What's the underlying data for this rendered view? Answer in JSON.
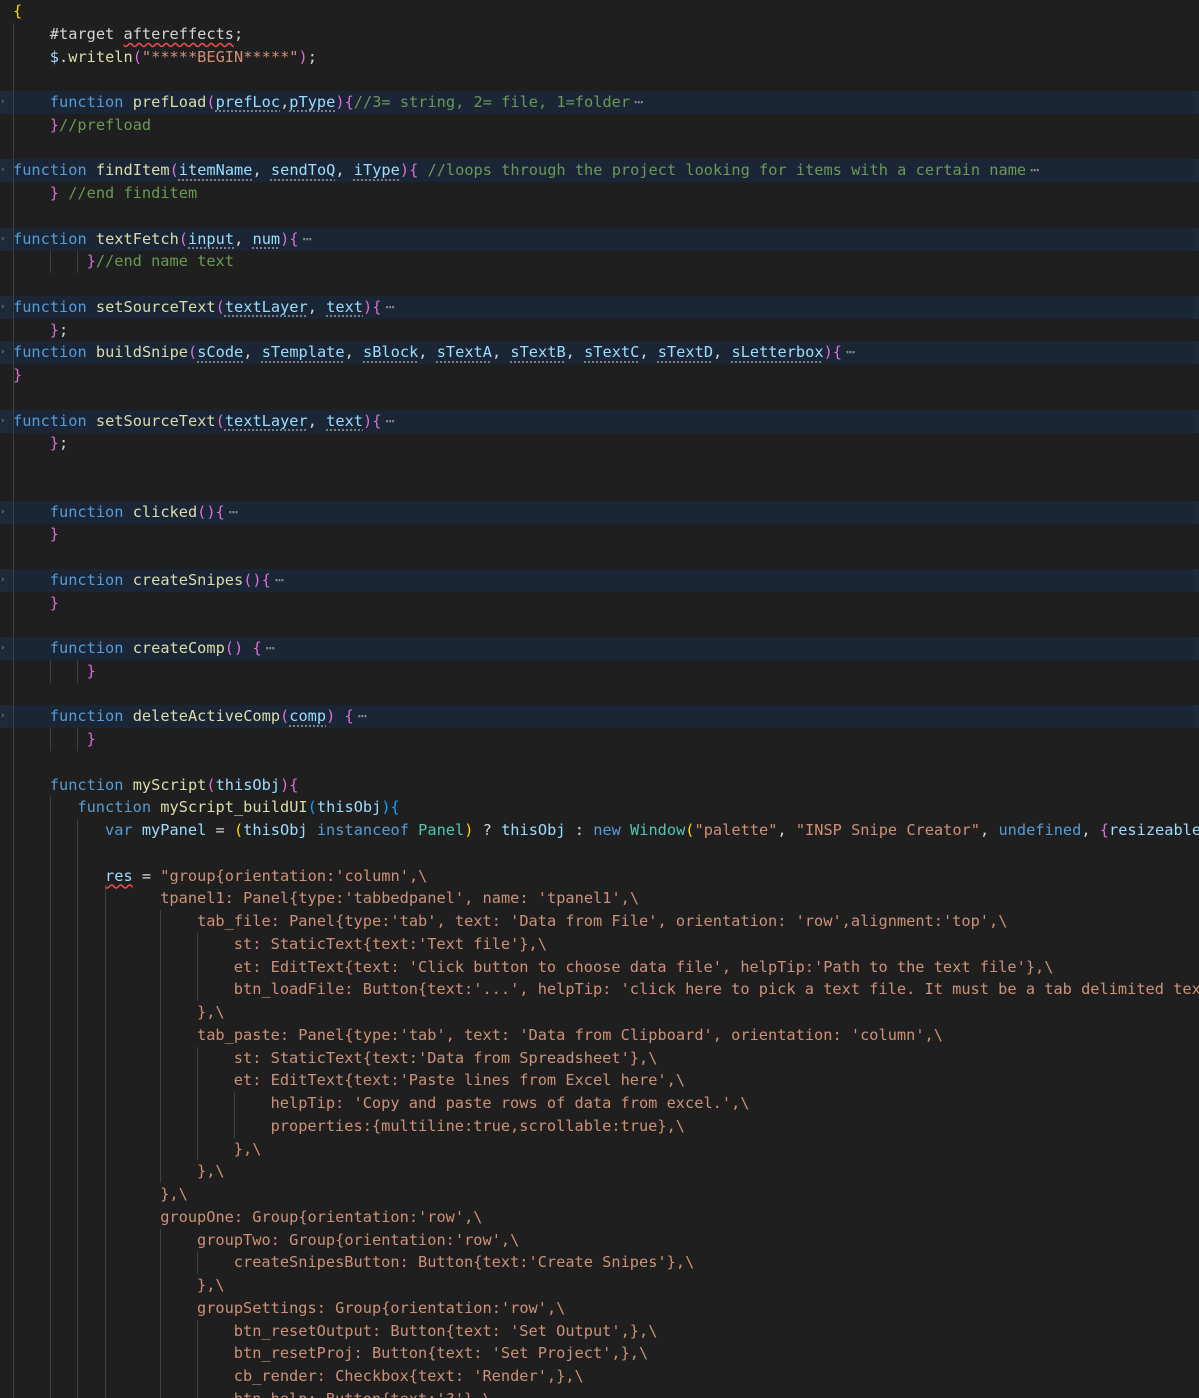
{
  "editor": {
    "fold_ellipsis": "⋯",
    "lines": [
      {
        "n": 1,
        "indent": 0,
        "folded": false,
        "tokens": [
          [
            "{",
            "b1"
          ]
        ]
      },
      {
        "n": 2,
        "indent": 4,
        "folded": false,
        "tokens": [
          [
            "#target ",
            "pl"
          ],
          [
            "aftereffects",
            "pl sq"
          ],
          [
            ";",
            "pl"
          ]
        ]
      },
      {
        "n": 3,
        "indent": 4,
        "folded": false,
        "tokens": [
          [
            "$",
            "p"
          ],
          [
            ".",
            "pl"
          ],
          [
            "writeln",
            "f"
          ],
          [
            "(",
            "b2"
          ],
          [
            "\"*****BEGIN*****\"",
            "s"
          ],
          [
            ")",
            "b2"
          ],
          [
            ";",
            "pl"
          ]
        ]
      },
      {
        "n": 4,
        "indent": 0,
        "folded": false,
        "tokens": []
      },
      {
        "n": 5,
        "indent": 4,
        "folded": true,
        "tokens": [
          [
            "function ",
            "k"
          ],
          [
            "prefLoad",
            "f"
          ],
          [
            "(",
            "b2"
          ],
          [
            "prefLoc",
            "p dt"
          ],
          [
            ",",
            "pl"
          ],
          [
            "pType",
            "p dt"
          ],
          [
            ")",
            "b2"
          ],
          [
            "{",
            "b2"
          ],
          [
            "//3= string, 2= file, 1=folder",
            "c"
          ]
        ]
      },
      {
        "n": 6,
        "indent": 4,
        "folded": false,
        "tokens": [
          [
            "}",
            "b2"
          ],
          [
            "//prefload",
            "c"
          ]
        ]
      },
      {
        "n": 7,
        "indent": 0,
        "folded": false,
        "tokens": []
      },
      {
        "n": 8,
        "indent": 0,
        "folded": true,
        "tokens": [
          [
            "function ",
            "k"
          ],
          [
            "findItem",
            "f"
          ],
          [
            "(",
            "b2"
          ],
          [
            "itemName",
            "p dt"
          ],
          [
            ", ",
            "pl"
          ],
          [
            "sendToQ",
            "p dt"
          ],
          [
            ", ",
            "pl"
          ],
          [
            "iType",
            "p dt"
          ],
          [
            ")",
            "b2"
          ],
          [
            "{ ",
            "b2"
          ],
          [
            "//loops through the project looking for items with a certain name",
            "c"
          ]
        ]
      },
      {
        "n": 9,
        "indent": 4,
        "folded": false,
        "tokens": [
          [
            "} ",
            "b2"
          ],
          [
            "//end finditem",
            "c"
          ]
        ]
      },
      {
        "n": 10,
        "indent": 0,
        "folded": false,
        "tokens": []
      },
      {
        "n": 11,
        "indent": 0,
        "folded": true,
        "tokens": [
          [
            "function ",
            "k"
          ],
          [
            "textFetch",
            "f"
          ],
          [
            "(",
            "b2"
          ],
          [
            "input",
            "p dt"
          ],
          [
            ", ",
            "pl"
          ],
          [
            "num",
            "p dt"
          ],
          [
            ")",
            "b2"
          ],
          [
            "{",
            "b2"
          ]
        ]
      },
      {
        "n": 12,
        "indent": 8,
        "folded": false,
        "tokens": [
          [
            "}",
            "b2"
          ],
          [
            "//end name text",
            "c"
          ]
        ]
      },
      {
        "n": 13,
        "indent": 0,
        "folded": false,
        "tokens": []
      },
      {
        "n": 14,
        "indent": 0,
        "folded": true,
        "tokens": [
          [
            "function ",
            "k"
          ],
          [
            "setSourceText",
            "f"
          ],
          [
            "(",
            "b2"
          ],
          [
            "textLayer",
            "p dt"
          ],
          [
            ", ",
            "pl"
          ],
          [
            "text",
            "p dt"
          ],
          [
            ")",
            "b2"
          ],
          [
            "{",
            "b2"
          ]
        ]
      },
      {
        "n": 15,
        "indent": 4,
        "folded": false,
        "tokens": [
          [
            "}",
            "b2"
          ],
          [
            ";",
            "pl"
          ]
        ]
      },
      {
        "n": 16,
        "indent": 0,
        "folded": true,
        "tokens": [
          [
            "function ",
            "k"
          ],
          [
            "buildSnipe",
            "f"
          ],
          [
            "(",
            "b2"
          ],
          [
            "sCode",
            "p dt"
          ],
          [
            ", ",
            "pl"
          ],
          [
            "sTemplate",
            "p dt"
          ],
          [
            ", ",
            "pl"
          ],
          [
            "sBlock",
            "p dt"
          ],
          [
            ", ",
            "pl"
          ],
          [
            "sTextA",
            "p dt"
          ],
          [
            ", ",
            "pl"
          ],
          [
            "sTextB",
            "p dt"
          ],
          [
            ", ",
            "pl"
          ],
          [
            "sTextC",
            "p dt"
          ],
          [
            ", ",
            "pl"
          ],
          [
            "sTextD",
            "p dt"
          ],
          [
            ", ",
            "pl"
          ],
          [
            "sLetterbox",
            "p dt"
          ],
          [
            ")",
            "b2"
          ],
          [
            "{",
            "b2"
          ]
        ]
      },
      {
        "n": 17,
        "indent": 0,
        "folded": false,
        "tokens": [
          [
            "}",
            "b2"
          ]
        ]
      },
      {
        "n": 18,
        "indent": 0,
        "folded": false,
        "tokens": []
      },
      {
        "n": 19,
        "indent": 0,
        "folded": true,
        "tokens": [
          [
            "function ",
            "k"
          ],
          [
            "setSourceText",
            "f"
          ],
          [
            "(",
            "b2"
          ],
          [
            "textLayer",
            "p dt"
          ],
          [
            ", ",
            "pl"
          ],
          [
            "text",
            "p dt"
          ],
          [
            ")",
            "b2"
          ],
          [
            "{",
            "b2"
          ]
        ]
      },
      {
        "n": 20,
        "indent": 4,
        "folded": false,
        "tokens": [
          [
            "}",
            "b2"
          ],
          [
            ";",
            "pl"
          ]
        ]
      },
      {
        "n": 21,
        "indent": 0,
        "folded": false,
        "tokens": []
      },
      {
        "n": 22,
        "indent": 0,
        "folded": false,
        "tokens": []
      },
      {
        "n": 23,
        "indent": 4,
        "folded": true,
        "tokens": [
          [
            "function ",
            "k"
          ],
          [
            "clicked",
            "f"
          ],
          [
            "()",
            "b2"
          ],
          [
            "{",
            "b2"
          ]
        ]
      },
      {
        "n": 24,
        "indent": 4,
        "folded": false,
        "tokens": [
          [
            "}",
            "b2"
          ]
        ]
      },
      {
        "n": 25,
        "indent": 0,
        "folded": false,
        "tokens": []
      },
      {
        "n": 26,
        "indent": 4,
        "folded": true,
        "tokens": [
          [
            "function ",
            "k"
          ],
          [
            "createSnipes",
            "f"
          ],
          [
            "()",
            "b2"
          ],
          [
            "{",
            "b2"
          ]
        ]
      },
      {
        "n": 27,
        "indent": 4,
        "folded": false,
        "tokens": [
          [
            "}",
            "b2"
          ]
        ]
      },
      {
        "n": 28,
        "indent": 0,
        "folded": false,
        "tokens": []
      },
      {
        "n": 29,
        "indent": 4,
        "folded": true,
        "tokens": [
          [
            "function ",
            "k"
          ],
          [
            "createComp",
            "f"
          ],
          [
            "() ",
            "b2"
          ],
          [
            "{",
            "b2"
          ]
        ]
      },
      {
        "n": 30,
        "indent": 8,
        "folded": false,
        "tokens": [
          [
            "}",
            "b2"
          ]
        ]
      },
      {
        "n": 31,
        "indent": 0,
        "folded": false,
        "tokens": []
      },
      {
        "n": 32,
        "indent": 4,
        "folded": true,
        "tokens": [
          [
            "function ",
            "k"
          ],
          [
            "deleteActiveComp",
            "f"
          ],
          [
            "(",
            "b2"
          ],
          [
            "comp",
            "p dt"
          ],
          [
            ") ",
            "b2"
          ],
          [
            "{",
            "b2"
          ]
        ]
      },
      {
        "n": 33,
        "indent": 8,
        "folded": false,
        "tokens": [
          [
            "}",
            "b2"
          ]
        ]
      },
      {
        "n": 34,
        "indent": 0,
        "folded": false,
        "tokens": []
      },
      {
        "n": 35,
        "indent": 4,
        "folded": false,
        "tokens": [
          [
            "function ",
            "k"
          ],
          [
            "myScript",
            "f"
          ],
          [
            "(",
            "b2"
          ],
          [
            "thisObj",
            "p"
          ],
          [
            ")",
            "b2"
          ],
          [
            "{",
            "b2"
          ]
        ]
      },
      {
        "n": 36,
        "indent": 7,
        "folded": false,
        "tokens": [
          [
            "function ",
            "k"
          ],
          [
            "myScript_buildUI",
            "f"
          ],
          [
            "(",
            "b3"
          ],
          [
            "thisObj",
            "p"
          ],
          [
            ")",
            "b3"
          ],
          [
            "{",
            "b3"
          ]
        ]
      },
      {
        "n": 37,
        "indent": 10,
        "folded": false,
        "tokens": [
          [
            "var ",
            "k"
          ],
          [
            "myPanel",
            "p"
          ],
          [
            " = ",
            "pl"
          ],
          [
            "(",
            "b1"
          ],
          [
            "thisObj",
            "p"
          ],
          [
            " instanceof ",
            "k"
          ],
          [
            "Panel",
            "t"
          ],
          [
            ")",
            "b1"
          ],
          [
            " ? ",
            "pl"
          ],
          [
            "thisObj",
            "p"
          ],
          [
            " : ",
            "pl"
          ],
          [
            "new ",
            "k"
          ],
          [
            "Window",
            "t"
          ],
          [
            "(",
            "b1"
          ],
          [
            "\"palette\"",
            "s"
          ],
          [
            ", ",
            "pl"
          ],
          [
            "\"INSP Snipe Creator\"",
            "s"
          ],
          [
            ", ",
            "pl"
          ],
          [
            "undefined",
            "k"
          ],
          [
            ", ",
            "pl"
          ],
          [
            "{",
            "b2"
          ],
          [
            "resizeable",
            "p"
          ]
        ]
      },
      {
        "n": 38,
        "indent": 0,
        "folded": false,
        "tokens": []
      },
      {
        "n": 39,
        "indent": 10,
        "folded": false,
        "tokens": [
          [
            "res",
            "p sq"
          ],
          [
            " = ",
            "pl"
          ],
          [
            "\"group{orientation:'column',\\",
            "s"
          ]
        ]
      },
      {
        "n": 40,
        "indent": 16,
        "folded": false,
        "tokens": [
          [
            "tpanel1: Panel{type:'tabbedpanel', name: 'tpanel1',\\",
            "s"
          ]
        ]
      },
      {
        "n": 41,
        "indent": 20,
        "folded": false,
        "tokens": [
          [
            "tab_file: Panel{type:'tab', text: 'Data from File', orientation: 'row',alignment:'top',\\",
            "s"
          ]
        ]
      },
      {
        "n": 42,
        "indent": 24,
        "folded": false,
        "tokens": [
          [
            "st: StaticText{text:'Text file'},\\",
            "s"
          ]
        ]
      },
      {
        "n": 43,
        "indent": 24,
        "folded": false,
        "tokens": [
          [
            "et: EditText{text: 'Click button to choose data file', helpTip:'Path to the text file'},\\",
            "s"
          ]
        ]
      },
      {
        "n": 44,
        "indent": 24,
        "folded": false,
        "tokens": [
          [
            "btn_loadFile: Button{text:'...', helpTip: 'click here to pick a text file. It must be a tab delimited text",
            "s"
          ]
        ]
      },
      {
        "n": 45,
        "indent": 20,
        "folded": false,
        "tokens": [
          [
            "},\\",
            "s"
          ]
        ]
      },
      {
        "n": 46,
        "indent": 20,
        "folded": false,
        "tokens": [
          [
            "tab_paste: Panel{type:'tab', text: 'Data from Clipboard', orientation: 'column',\\",
            "s"
          ]
        ]
      },
      {
        "n": 47,
        "indent": 24,
        "folded": false,
        "tokens": [
          [
            "st: StaticText{text:'Data from Spreadsheet'},\\",
            "s"
          ]
        ]
      },
      {
        "n": 48,
        "indent": 24,
        "folded": false,
        "tokens": [
          [
            "et: EditText{text:'Paste lines from Excel here',\\",
            "s"
          ]
        ]
      },
      {
        "n": 49,
        "indent": 28,
        "folded": false,
        "tokens": [
          [
            "helpTip: 'Copy and paste rows of data from excel.',\\",
            "s"
          ]
        ]
      },
      {
        "n": 50,
        "indent": 28,
        "folded": false,
        "tokens": [
          [
            "properties:{multiline:true,scrollable:true},\\",
            "s"
          ]
        ]
      },
      {
        "n": 51,
        "indent": 24,
        "folded": false,
        "tokens": [
          [
            "},\\",
            "s"
          ]
        ]
      },
      {
        "n": 52,
        "indent": 20,
        "folded": false,
        "tokens": [
          [
            "},\\",
            "s"
          ]
        ]
      },
      {
        "n": 53,
        "indent": 16,
        "folded": false,
        "tokens": [
          [
            "},\\",
            "s"
          ]
        ]
      },
      {
        "n": 54,
        "indent": 16,
        "folded": false,
        "tokens": [
          [
            "groupOne: Group{orientation:'row',\\",
            "s"
          ]
        ]
      },
      {
        "n": 55,
        "indent": 20,
        "folded": false,
        "tokens": [
          [
            "groupTwo: Group{orientation:'row',\\",
            "s"
          ]
        ]
      },
      {
        "n": 56,
        "indent": 24,
        "folded": false,
        "tokens": [
          [
            "createSnipesButton: Button{text:'Create Snipes'},\\",
            "s"
          ]
        ]
      },
      {
        "n": 57,
        "indent": 20,
        "folded": false,
        "tokens": [
          [
            "},\\",
            "s"
          ]
        ]
      },
      {
        "n": 58,
        "indent": 20,
        "folded": false,
        "tokens": [
          [
            "groupSettings: Group{orientation:'row',\\",
            "s"
          ]
        ]
      },
      {
        "n": 59,
        "indent": 24,
        "folded": false,
        "tokens": [
          [
            "btn_resetOutput: Button{text: 'Set Output',},\\",
            "s"
          ]
        ]
      },
      {
        "n": 60,
        "indent": 24,
        "folded": false,
        "tokens": [
          [
            "btn_resetProj: Button{text: 'Set Project',},\\",
            "s"
          ]
        ]
      },
      {
        "n": 61,
        "indent": 24,
        "folded": false,
        "tokens": [
          [
            "cb_render: Checkbox{text: 'Render',},\\",
            "s"
          ]
        ]
      },
      {
        "n": 62,
        "indent": 24,
        "folded": false,
        "tokens": [
          [
            "btn_help: Button{text:'?'},\\",
            "s"
          ]
        ]
      }
    ]
  },
  "colors": {
    "background": "#1f1f1f",
    "folded_highlight": "#1a2636",
    "keyword": "#569cd6",
    "function_name": "#dcdcaa",
    "parameter": "#9cdcfe",
    "string": "#ce9178",
    "comment": "#6a9955",
    "type": "#4ec9b0",
    "bracket_1": "#ffd700",
    "bracket_2": "#da70d6",
    "bracket_3": "#179fff"
  }
}
